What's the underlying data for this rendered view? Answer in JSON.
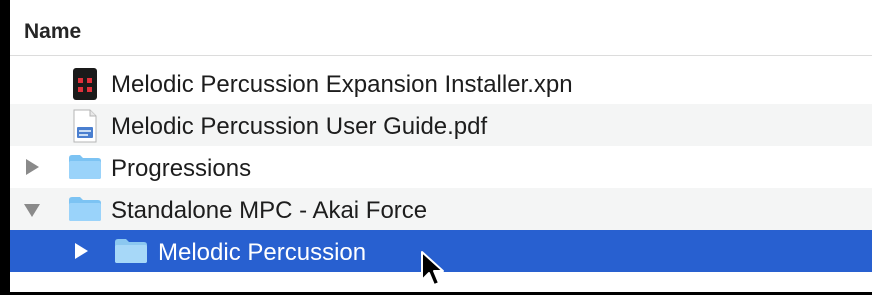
{
  "header": {
    "name_column": "Name"
  },
  "rows": [
    {
      "name": "Melodic Percussion Expansion Installer.xpn",
      "kind": "xpn-file",
      "icon": "xpn-file-icon"
    },
    {
      "name": "Melodic Percussion User Guide.pdf",
      "kind": "pdf-file",
      "icon": "pdf-file-icon"
    },
    {
      "name": "Progressions",
      "kind": "folder",
      "icon": "folder-icon",
      "disclosure": "collapsed"
    },
    {
      "name": "Standalone MPC - Akai Force",
      "kind": "folder",
      "icon": "folder-icon",
      "disclosure": "expanded"
    },
    {
      "name": "Melodic Percussion",
      "kind": "folder",
      "icon": "folder-icon",
      "disclosure": "collapsed",
      "selected": true
    }
  ],
  "colors": {
    "selection": "#2860d0",
    "folder": "#8ecdf7"
  }
}
